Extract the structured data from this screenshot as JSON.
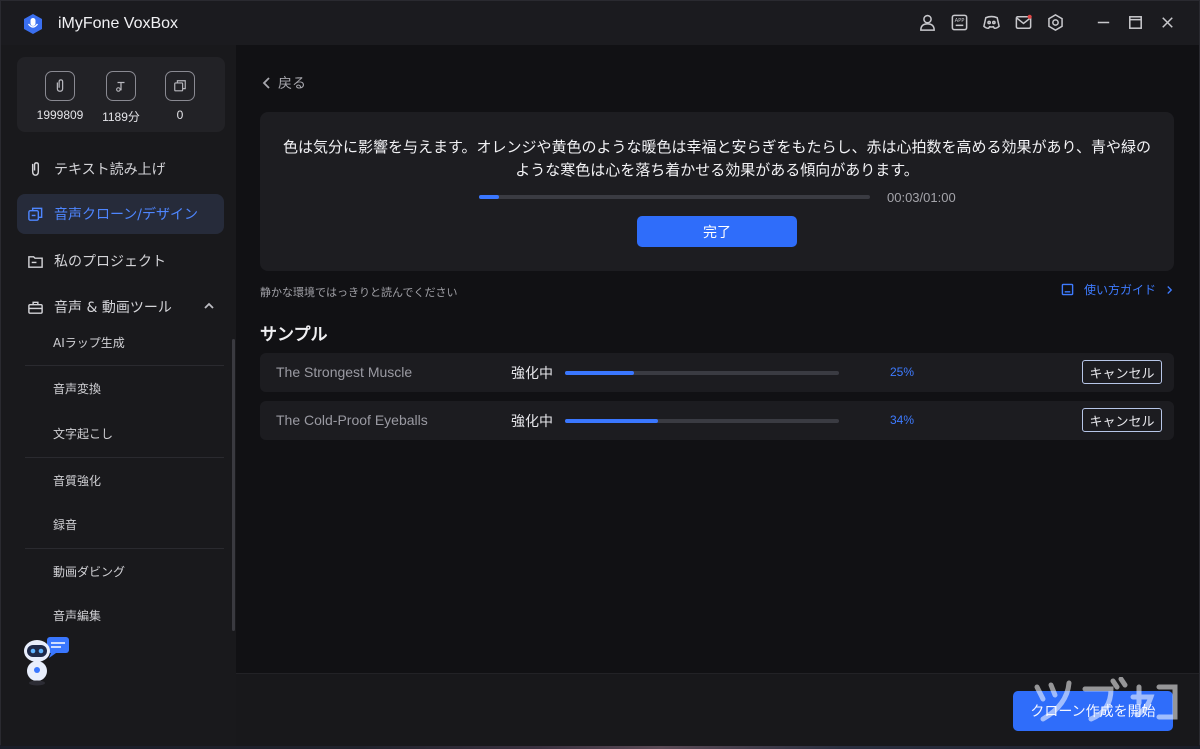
{
  "app": {
    "title": "iMyFone VoxBox",
    "brand_color": "#2f6dfa"
  },
  "titlebar": {
    "icons": [
      "user-icon",
      "app-icon",
      "discord-icon",
      "mail-icon",
      "settings-icon",
      "minimize-icon",
      "maximize-icon",
      "close-icon"
    ]
  },
  "stats": [
    {
      "icon": "clip-icon",
      "value": "1999809"
    },
    {
      "icon": "text-icon",
      "value": "1189分"
    },
    {
      "icon": "copy-icon",
      "value": "0"
    }
  ],
  "nav": {
    "tts": "テキスト読み上げ",
    "clone": "音声クローン/デザイン",
    "projects": "私のプロジェクト",
    "tools": "音声 & 動画ツール",
    "sub": [
      "AIラップ生成",
      "音声変換",
      "文字起こし",
      "音質強化",
      "録音",
      "動画ダビング",
      "音声編集"
    ]
  },
  "main": {
    "back": "戻る",
    "script": "色は気分に影響を与えます。オレンジや黄色のような暖色は幸福と安らぎをもたらし、赤は心拍数を高める効果があり、青や緑のような寒色は心を落ち着かせる効果がある傾向があります。",
    "recording_progress": 0.05,
    "time": "00:03/01:00",
    "done": "完了",
    "hint": "静かな環境ではっきりと読んでください",
    "guide": "使い方ガイド",
    "section": "サンプル",
    "samples": [
      {
        "name": "The Strongest Muscle",
        "status": "強化中",
        "progress": 0.25,
        "pct": "25%",
        "cancel": "キャンセル"
      },
      {
        "name": "The Cold-Proof Eyeballs",
        "status": "強化中",
        "progress": 0.34,
        "pct": "34%",
        "cancel": "キャンセル"
      }
    ]
  },
  "footer": {
    "start": "クローン作成を開始"
  }
}
